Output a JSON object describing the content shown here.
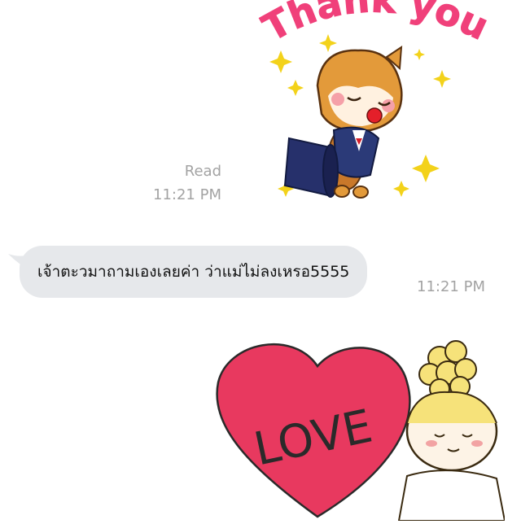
{
  "messages": [
    {
      "type": "sticker",
      "sticker_text": "Thank you",
      "status": "Read",
      "time": "11:21 PM"
    },
    {
      "type": "text",
      "text": "เจ้าตะวมาถามเองเลยค่า ว่าแม่ไม่ลงเหรอ5555",
      "time": "11:21 PM"
    },
    {
      "type": "sticker",
      "sticker_text": "LOVE"
    }
  ],
  "colors": {
    "bubble_bg": "#e6e8eb",
    "meta_text": "#a3a3a3",
    "thankyou_pink": "#f0407a",
    "heart_red": "#e8395f"
  }
}
